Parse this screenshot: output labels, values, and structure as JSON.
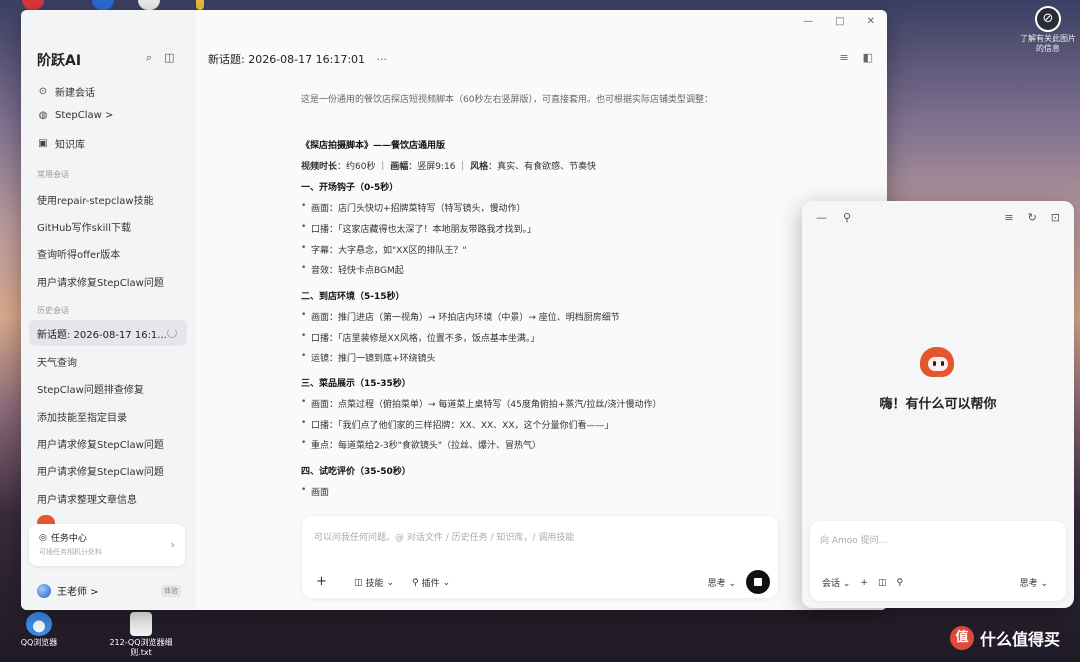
{
  "desktop": {
    "right_icon_glyph": "⊘",
    "right_icon_label": "了解有关此图片的信息",
    "bottom_icons": [
      {
        "label": "QQ浏览器"
      },
      {
        "label": "212-QQ浏览器细则.txt"
      }
    ],
    "watermark_text": "什么值得买",
    "watermark_badge": "值"
  },
  "window": {
    "controls": [
      "—",
      "□",
      "✕"
    ]
  },
  "sidebar": {
    "brand": "阶跃AI",
    "search_glyph": "⌕",
    "layout_glyph": "◫",
    "items": [
      {
        "icon": "⊙",
        "label": "新建会话"
      },
      {
        "icon": "◍",
        "label": "StepClaw >"
      },
      {
        "icon": "▣",
        "label": "知识库"
      }
    ],
    "section_frequent": "常用会话",
    "frequent": [
      "使用repair-stepclaw技能",
      "GitHub写作skill下载",
      "查询听得offer版本",
      "用户请求修复StepClaw问题"
    ],
    "section_history": "历史会话",
    "active_conversation": "新话题: 2026-08-17 16:1...",
    "history": [
      "天气查询",
      "StepClaw问题排查修复",
      "添加技能至指定目录",
      "用户请求修复StepClaw问题",
      "用户请求修复StepClaw问题",
      "用户请求整理文章信息"
    ],
    "task_card": {
      "title": "任务中心",
      "subtitle": "可插任务相机分处料",
      "icon": "◎",
      "arrow": "›"
    },
    "user": {
      "name": "王老师 >",
      "tag": "体验"
    }
  },
  "main": {
    "header_title": "新话题: 2026-08-17 16:17:01",
    "header_more": "···",
    "header_tools": [
      "≡",
      "◧"
    ],
    "intro": "这是一份通用的餐饮店探店短视频脚本（60秒左右竖屏版），可直接套用。也可根据实际店铺类型调整：",
    "title": "《探店拍摄脚本》——餐饮店通用版",
    "meta": {
      "duration_label": "视频时长",
      "duration_value": "：约60秒 ｜ ",
      "ratio_label": "画幅",
      "ratio_value": "：竖屏9:16 ｜ ",
      "style_label": "风格",
      "style_value": "：真实、有食欲感、节奏快"
    },
    "sections": [
      {
        "heading": "一、开场钩子（0-5秒）",
        "bullets": [
          "画面：店门头快切+招牌菜特写（特写镜头，慢动作）",
          "口播：「这家店藏得也太深了！本地朋友带路我才找到。」",
          "字幕：大字悬念，如\"XX区的排队王？\"",
          "音效：轻快卡点BGM起"
        ]
      },
      {
        "heading": "二、到店环境（5-15秒）",
        "bullets": [
          "画面：推门进店（第一视角）→ 环拍店内环境（中景）→ 座位、明档厨房细节",
          "口播：「店里装修是XX风格，位置不多，饭点基本坐满。」",
          "运镜：推门一镜到底+环绕镜头"
        ]
      },
      {
        "heading": "三、菜品展示（15-35秒）",
        "bullets": [
          "画面：点菜过程（俯拍菜单）→ 每道菜上桌特写（45度角俯拍+蒸汽/拉丝/浇汁慢动作）",
          "口播：「我们点了他们家的三样招牌：XX、XX、XX，这个分量你们看——」",
          "重点：每道菜给2-3秒\"食欲镜头\"（拉丝、爆汁、冒热气）"
        ]
      },
      {
        "heading": "四、试吃评价（35-50秒）",
        "bullets": [
          "画面"
        ]
      }
    ],
    "composer": {
      "placeholder": "可以问我任何问题。@ 对话文件 / 历史任务 / 知识库，/ 调用技能",
      "plus": "+",
      "skills_label": "技能",
      "skills_icon": "◫",
      "plugins_label": "插件",
      "plugins_icon": "⚲",
      "chevron": "⌄",
      "think_label": "思考 ⌄"
    }
  },
  "panel": {
    "tools_left": [
      "—",
      "⚲"
    ],
    "tools_right": [
      "≡",
      "↻",
      "⊡"
    ],
    "greeting": "嗨！有什么可以帮你",
    "placeholder": "向 Amoo 提问...",
    "actions": [
      "会话 ⌄",
      "+",
      "◫",
      "⚲"
    ],
    "think_label": "思考 ⌄"
  }
}
